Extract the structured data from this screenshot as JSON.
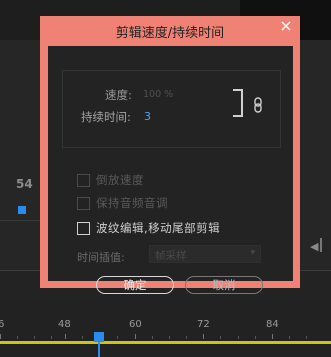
{
  "dialog": {
    "title": "剪辑速度/持续时间",
    "speed_label": "速度:",
    "speed_value": "100 %",
    "duration_label": "持续时间:",
    "duration_value": "3",
    "link_icon": "link-icon",
    "close_icon": "close-icon",
    "checkboxes": [
      {
        "label": "倒放速度",
        "checked": false,
        "enabled": false
      },
      {
        "label": "保持音频音调",
        "checked": false,
        "enabled": false
      },
      {
        "label": "波纹编辑,移动尾部剪辑",
        "checked": false,
        "enabled": true
      }
    ],
    "interp_label": "时间插值:",
    "interp_value": "帧采样",
    "ok_label": "确定",
    "cancel_label": "取消",
    "titlebar_color": "#f08275"
  },
  "background": {
    "frame_number": "54",
    "ruler_ticks": [
      "6",
      "48",
      "60",
      "72",
      "84"
    ],
    "playhead_color": "#2d8ceb"
  }
}
